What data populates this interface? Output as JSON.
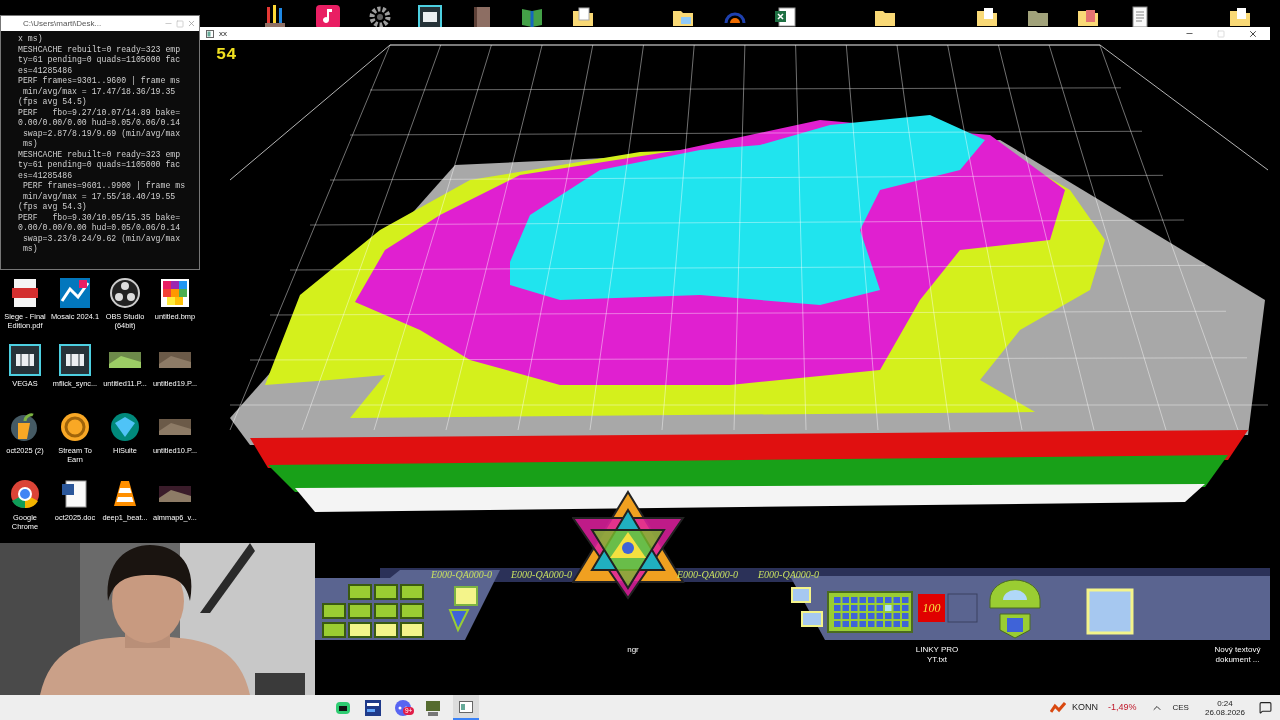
{
  "console": {
    "title": "C:\\Users\\marti\\Desk...",
    "lines": [
      "x ms)",
      "MESHCACHE rebuilt=0 ready=323 emp",
      "ty=61 pending=0 quads=1105000 fac",
      "es=41285486",
      "PERF frames=9301..9600 | frame ms",
      " min/avg/max = 17.47/18.36/19.35",
      "(fps avg 54.5)",
      "PERF   fbo=9.27/10.07/14.89 bake=",
      "0.00/0.00/0.00 hud=0.05/0.06/0.14",
      " swap=2.87/8.19/9.69 (min/avg/max",
      " ms)",
      "MESHCACHE rebuilt=0 ready=323 emp",
      "ty=61 pending=0 quads=1105000 fac",
      "es=41285486",
      " PERF frames=9601..9900 | frame ms",
      " min/avg/max = 17.55/18.40/19.55",
      "(fps avg 54.3)",
      "PERF   fbo=9.30/10.05/15.35 bake=",
      "0.00/0.00/0.00 hud=0.05/0.06/0.14",
      " swap=3.23/8.24/9.62 (min/avg/max",
      " ms)"
    ]
  },
  "desktop_icons": [
    {
      "label": "Siege - Final Edition.pdf"
    },
    {
      "label": "Mosaic 2024.1"
    },
    {
      "label": "OBS Studio (64bit)"
    },
    {
      "label": "untitled.bmp"
    },
    {
      "label": "VEGAS"
    },
    {
      "label": "mflick_sync..."
    },
    {
      "label": "untitled11.P..."
    },
    {
      "label": "untitled19.P..."
    },
    {
      "label": "oct2025 (2)"
    },
    {
      "label": "Stream To Earn"
    },
    {
      "label": "HiSuite"
    },
    {
      "label": "untitled10.P..."
    },
    {
      "label": "Google Chrome"
    },
    {
      "label": "oct2025.doc"
    },
    {
      "label": "deep1_beat..."
    },
    {
      "label": "aimmap6_v..."
    }
  ],
  "game_window": {
    "title": "xx",
    "fps": "54",
    "hud_codes": [
      "E000-QA000-0",
      "E000-QA000-0",
      "E000-QA000-0",
      "E000-QA000-0"
    ],
    "counter": "100"
  },
  "desktop_labels": [
    "ngr",
    "LINKY PRO YT.txt",
    "Nový textový dokument ..."
  ],
  "taskbar": {
    "badge": "9+",
    "ticker": "KONN",
    "change": "-1,49%",
    "language": "CES",
    "time": "0:24",
    "date": "26.08.2026"
  }
}
